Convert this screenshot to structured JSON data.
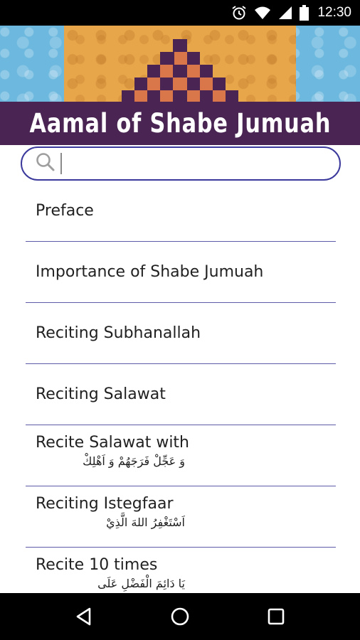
{
  "status_bar": {
    "time": "12:30",
    "icons": [
      "alarm-icon",
      "wifi-icon",
      "cell-signal-icon",
      "battery-icon"
    ]
  },
  "banner": {
    "title": "Aamal of Shabe Jumuah",
    "colors": {
      "sky": "#6cb8de",
      "panel": "#e8a64a",
      "title_bar": "#4a2452",
      "block_dark": "#4a2452",
      "block_orange": "#d9774a"
    }
  },
  "search": {
    "value": "",
    "placeholder": "",
    "icon": "search-icon",
    "border_color": "#3b3a9c"
  },
  "list": {
    "items": [
      {
        "title": "Preface",
        "subtitle": ""
      },
      {
        "title": "Importance of Shabe Jumuah",
        "subtitle": ""
      },
      {
        "title": "Reciting Subhanallah",
        "subtitle": ""
      },
      {
        "title": "Reciting Salawat",
        "subtitle": ""
      },
      {
        "title": "Recite Salawat with",
        "subtitle": "وَ عَجِّلْ فَرَجَهُمْ وَ اَهْلِكْ"
      },
      {
        "title": "Reciting Istegfaar",
        "subtitle": "اَسْتَغْفِرُ اللهَ الَّذِيْ"
      },
      {
        "title": "Recite 10 times",
        "subtitle": "يَا دَائِمَ الْفَضْلِ عَلَى"
      }
    ],
    "divider_color": "#5d5aa8"
  },
  "nav_bar": {
    "buttons": [
      "back-icon",
      "home-icon",
      "recents-icon"
    ]
  }
}
